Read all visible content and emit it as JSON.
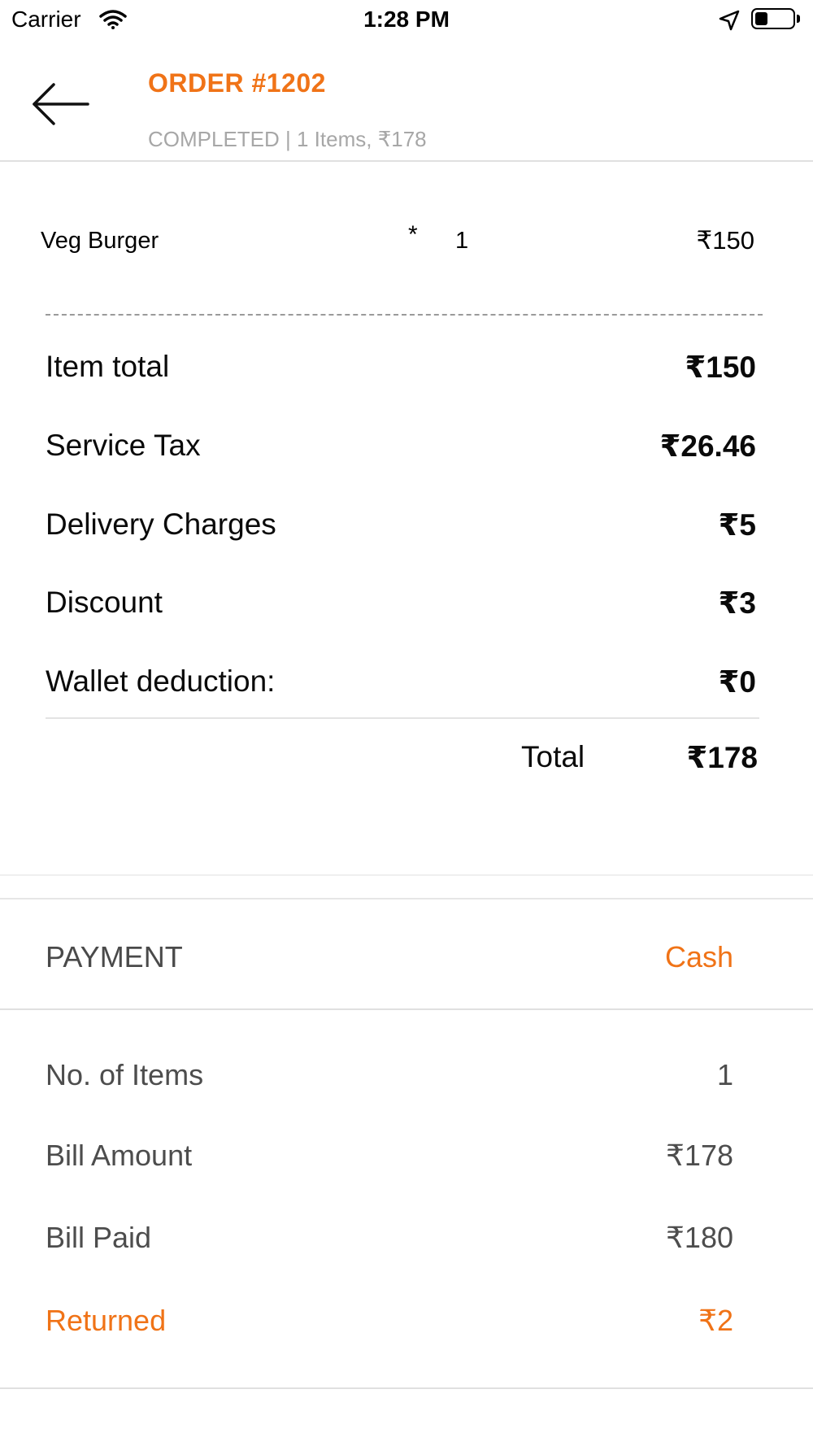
{
  "status_bar": {
    "carrier": "Carrier",
    "time": "1:28 PM",
    "battery_level": 0.35
  },
  "header": {
    "back_icon": "arrow-left-icon",
    "order_title": "ORDER #1202",
    "order_subtitle": "COMPLETED | 1 Items, ₹178"
  },
  "items": [
    {
      "name": "Veg Burger",
      "asterisk": "*",
      "quantity": "1",
      "price": "₹150"
    }
  ],
  "summary": {
    "rows": [
      {
        "label": "Item total",
        "value": "₹150"
      },
      {
        "label": "Service Tax",
        "value": "₹26.46"
      },
      {
        "label": "Delivery Charges",
        "value": "₹5"
      },
      {
        "label": "Discount",
        "value": "₹3"
      },
      {
        "label": "Wallet deduction:",
        "value": "₹0"
      }
    ],
    "total_label": "Total",
    "total_value": "₹178"
  },
  "payment": {
    "label": "PAYMENT",
    "method": "Cash"
  },
  "bill": {
    "rows": [
      {
        "label": "No. of Items",
        "value": "1"
      },
      {
        "label": "Bill Amount",
        "value": "₹178"
      },
      {
        "label": "Bill Paid",
        "value": "₹180"
      },
      {
        "label": "Returned",
        "value": "₹2"
      }
    ]
  },
  "colors": {
    "accent": "#f07317",
    "muted_text": "#a7a7a7",
    "body_text": "#0a0a0a",
    "divider": "#e0e0e0"
  }
}
